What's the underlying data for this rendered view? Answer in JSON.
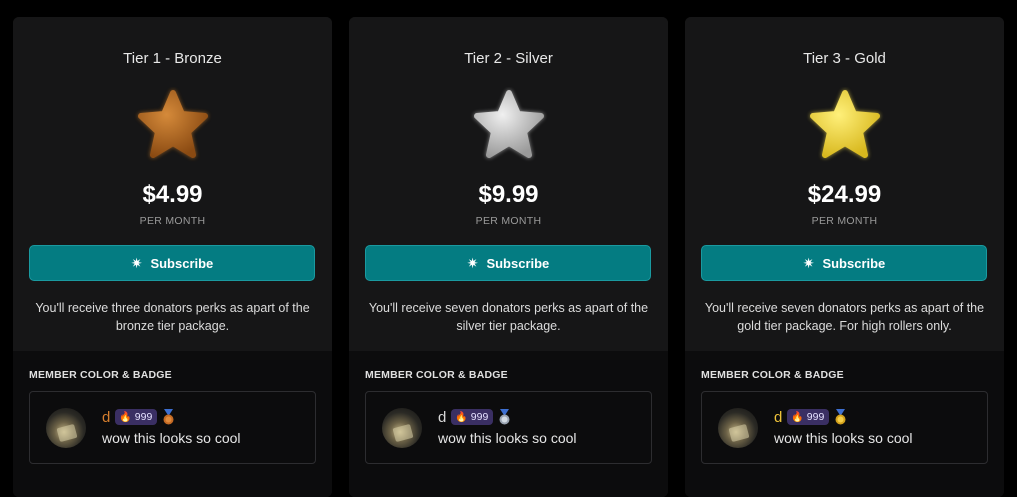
{
  "tiers": [
    {
      "title": "Tier 1 - Bronze",
      "price": "$4.99",
      "period": "PER MONTH",
      "button": "Subscribe",
      "description": "You'll receive three donators perks as apart of the bronze tier package.",
      "section_label": "MEMBER COLOR & BADGE",
      "preview": {
        "username": "d",
        "badge_count": "999",
        "message": "wow this looks so cool"
      },
      "star_icon": "bronze-star-icon",
      "colors": {
        "name": "#d77f2e",
        "star_light": "#c8782a",
        "star_dark": "#8a4a12",
        "medal": "#c46a24"
      }
    },
    {
      "title": "Tier 2 - Silver",
      "price": "$9.99",
      "period": "PER MONTH",
      "button": "Subscribe",
      "description": "You'll receive seven donators perks as apart of the silver tier package.",
      "section_label": "MEMBER COLOR & BADGE",
      "preview": {
        "username": "d",
        "badge_count": "999",
        "message": "wow this looks so cool"
      },
      "star_icon": "silver-star-icon",
      "colors": {
        "name": "#d9d9d9",
        "star_light": "#e2e2e2",
        "star_dark": "#9a9a9a",
        "medal": "#bfc7d2"
      }
    },
    {
      "title": "Tier 3 - Gold",
      "price": "$24.99",
      "period": "PER MONTH",
      "button": "Subscribe",
      "description": "You'll receive seven donators perks as apart of the gold tier package. For high rollers only.",
      "section_label": "MEMBER COLOR & BADGE",
      "preview": {
        "username": "d",
        "badge_count": "999",
        "message": "wow this looks so cool"
      },
      "star_icon": "gold-star-icon",
      "colors": {
        "name": "#f0c43a",
        "star_light": "#fff07a",
        "star_dark": "#d8b81e",
        "medal": "#f0c43a"
      }
    }
  ],
  "accent": "#047c82"
}
